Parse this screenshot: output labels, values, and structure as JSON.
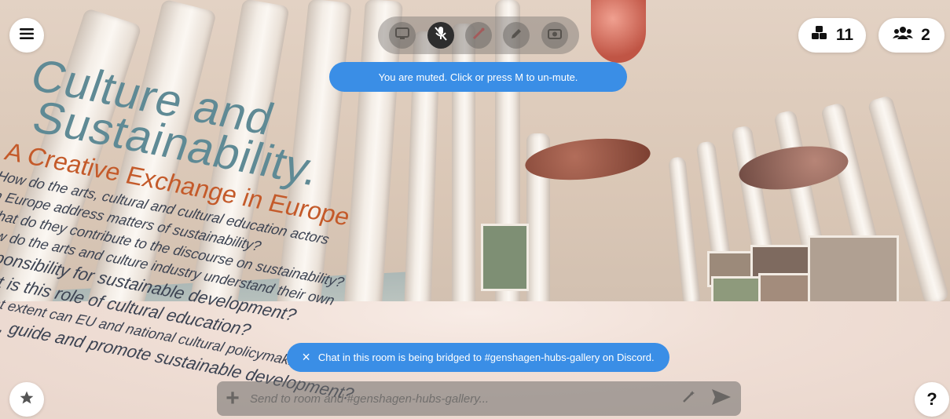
{
  "top_bar": {
    "menu_icon": "hamburger-icon",
    "objects_count": "11",
    "people_count": "2"
  },
  "toolbar": {
    "tools": [
      "screen-share-icon",
      "microphone-muted-icon",
      "pen-icon",
      "pencil-icon",
      "camera-icon"
    ],
    "active_tool": "microphone-muted-icon"
  },
  "mute_toast": {
    "text": "You are muted. Click or press M to un-mute."
  },
  "bridge_toast": {
    "close_label": "×",
    "text": "Chat in this room is being bridged to #genshagen-hubs-gallery on Discord."
  },
  "chat": {
    "placeholder": "Send to room and #genshagen-hubs-gallery...",
    "add_label": "+"
  },
  "help_label": "?",
  "wall_text": {
    "title_line1": "Culture and",
    "title_line2": "Sustainability.",
    "subtitle": "A Creative Exchange in Europe",
    "q1a": "How do the arts, cultural and cultural education actors",
    "q1b": "in Europe address matters of sustainability?",
    "q2": "What do they contribute to the discourse on sustainability?",
    "q3a": "How do the arts and culture industry understand their own",
    "q3b": "responsibility for sustainable development?",
    "q4": "What is this role of cultural education?",
    "q5a": "To what extent can EU and national cultural policymaking",
    "q5b": "enable, guide and promote sustainable development?"
  },
  "colors": {
    "accent": "#3a8ee6",
    "title": "#5f8a95",
    "subtitle": "#c45a2a"
  }
}
